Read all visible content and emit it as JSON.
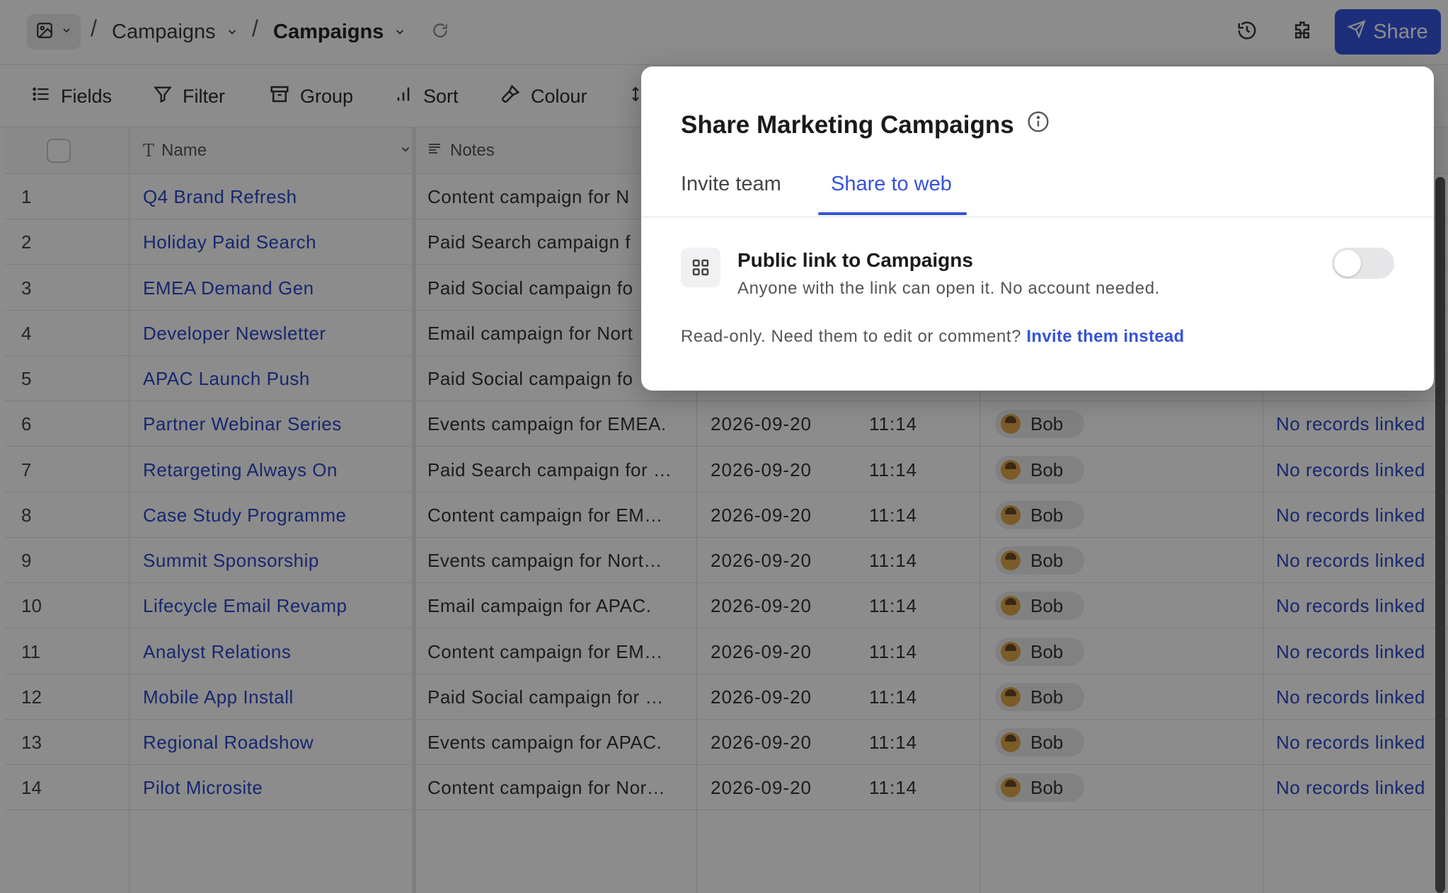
{
  "breadcrumb": {
    "base": "Campaigns",
    "table": "Campaigns"
  },
  "topbar": {
    "share_label": "Share"
  },
  "toolbar": {
    "fields": "Fields",
    "filter": "Filter",
    "group": "Group",
    "sort": "Sort",
    "colour": "Colour"
  },
  "columns": {
    "name": "Name",
    "notes": "Notes"
  },
  "rows": [
    {
      "num": "1",
      "name": "Q4 Brand Refresh",
      "notes": "Content campaign for N",
      "date": "",
      "time": "",
      "user": "",
      "link": ""
    },
    {
      "num": "2",
      "name": "Holiday Paid Search",
      "notes": "Paid Search campaign f",
      "date": "",
      "time": "",
      "user": "",
      "link": ""
    },
    {
      "num": "3",
      "name": "EMEA Demand Gen",
      "notes": "Paid Social campaign fo",
      "date": "",
      "time": "",
      "user": "",
      "link": ""
    },
    {
      "num": "4",
      "name": "Developer Newsletter",
      "notes": "Email campaign for Nort",
      "date": "",
      "time": "",
      "user": "",
      "link": ""
    },
    {
      "num": "5",
      "name": "APAC Launch Push",
      "notes": "Paid Social campaign fo",
      "date": "",
      "time": "",
      "user": "",
      "link": ""
    },
    {
      "num": "6",
      "name": "Partner Webinar Series",
      "notes": "Events campaign for EMEA.",
      "date": "2026-09-20",
      "time": "11:14",
      "user": "Bob",
      "link": "No records linked"
    },
    {
      "num": "7",
      "name": "Retargeting Always On",
      "notes": "Paid Search campaign for …",
      "date": "2026-09-20",
      "time": "11:14",
      "user": "Bob",
      "link": "No records linked"
    },
    {
      "num": "8",
      "name": "Case Study Programme",
      "notes": "Content campaign for EM…",
      "date": "2026-09-20",
      "time": "11:14",
      "user": "Bob",
      "link": "No records linked"
    },
    {
      "num": "9",
      "name": "Summit Sponsorship",
      "notes": "Events campaign for Nort…",
      "date": "2026-09-20",
      "time": "11:14",
      "user": "Bob",
      "link": "No records linked"
    },
    {
      "num": "10",
      "name": "Lifecycle Email Revamp",
      "notes": "Email campaign for APAC.",
      "date": "2026-09-20",
      "time": "11:14",
      "user": "Bob",
      "link": "No records linked"
    },
    {
      "num": "11",
      "name": "Analyst Relations",
      "notes": "Content campaign for EM…",
      "date": "2026-09-20",
      "time": "11:14",
      "user": "Bob",
      "link": "No records linked"
    },
    {
      "num": "12",
      "name": "Mobile App Install",
      "notes": "Paid Social campaign for …",
      "date": "2026-09-20",
      "time": "11:14",
      "user": "Bob",
      "link": "No records linked"
    },
    {
      "num": "13",
      "name": "Regional Roadshow",
      "notes": "Events campaign for APAC.",
      "date": "2026-09-20",
      "time": "11:14",
      "user": "Bob",
      "link": "No records linked"
    },
    {
      "num": "14",
      "name": "Pilot Microsite",
      "notes": "Content campaign for Nor…",
      "date": "2026-09-20",
      "time": "11:14",
      "user": "Bob",
      "link": "No records linked"
    }
  ],
  "add_row_symbol": "+",
  "modal": {
    "title": "Share Marketing Campaigns",
    "tabs": [
      "Invite team",
      "Share to web"
    ],
    "active_tab": "Share to web",
    "public_link_title": "Public link to Campaigns",
    "public_link_sub": "Anyone with the link can open it. No account needed.",
    "public_link_enabled": false,
    "footer_text": "Read-only. Need them to edit or comment?",
    "footer_link": "Invite them instead"
  },
  "colors": {
    "accent": "#3553d8",
    "share_button": "#3656e0",
    "link_text": "#2b47c9"
  }
}
